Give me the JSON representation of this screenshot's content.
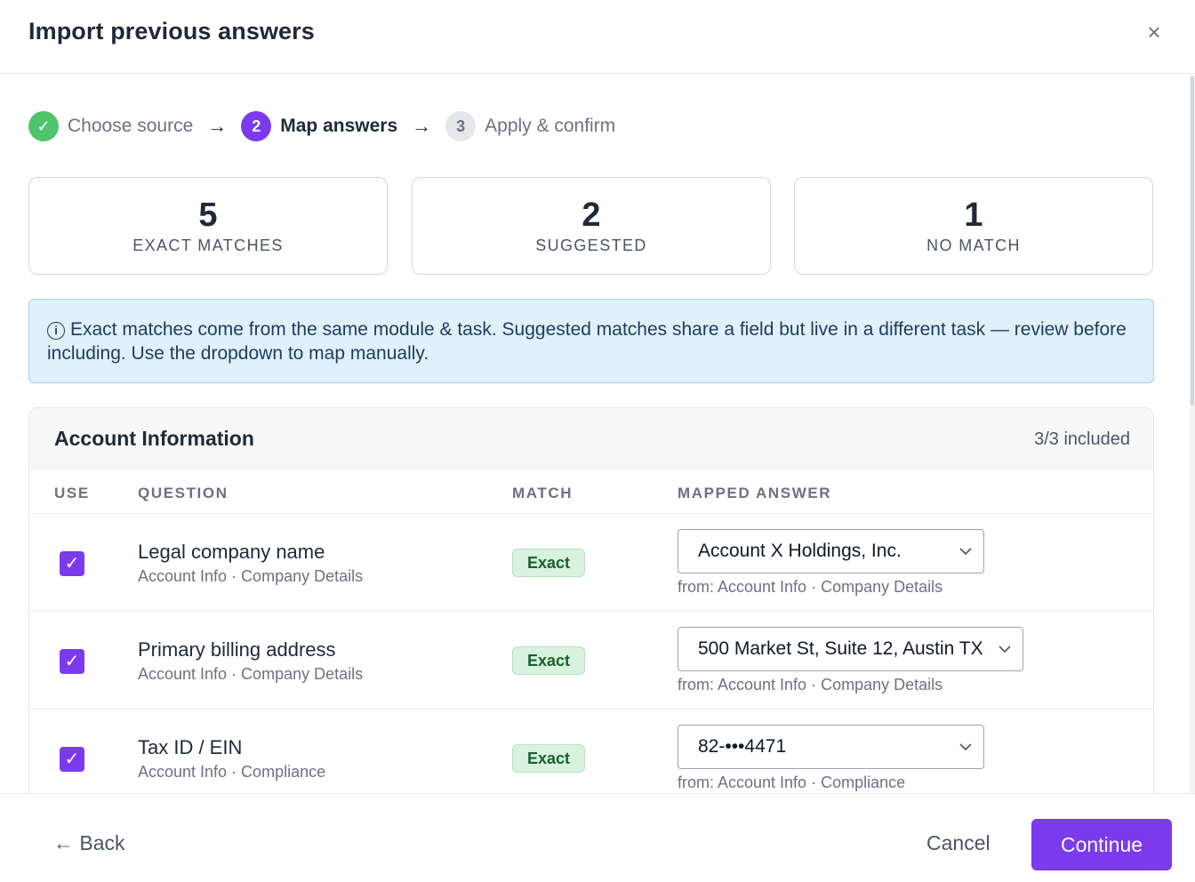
{
  "modal": {
    "title": "Import previous answers",
    "close_icon": "close-icon"
  },
  "stepper": {
    "steps": [
      {
        "label": "Choose source",
        "state": "done",
        "marker": "✓"
      },
      {
        "label": "Map answers",
        "state": "active",
        "marker": "2"
      },
      {
        "label": "Apply & confirm",
        "state": "todo",
        "marker": "3"
      }
    ],
    "arrow": "→"
  },
  "stats": [
    {
      "value": "5",
      "label": "EXACT MATCHES"
    },
    {
      "value": "2",
      "label": "SUGGESTED"
    },
    {
      "value": "1",
      "label": "NO MATCH"
    }
  ],
  "info_banner": {
    "icon": "ⓘ",
    "text": "Exact matches come from the same module & task. Suggested matches share a field but live in a different task — review before including. Use the dropdown to map manually."
  },
  "section": {
    "title": "Account Information",
    "count": "3/3 included",
    "columns": [
      "USE",
      "QUESTION",
      "MATCH",
      "MAPPED ANSWER"
    ],
    "rows": [
      {
        "checked": true,
        "question": "Legal company name",
        "path": "Account Info · Company Details",
        "match": "Exact",
        "answer": "Account X Holdings, Inc.",
        "from": "from: Account Info · Company Details"
      },
      {
        "checked": true,
        "question": "Primary billing address",
        "path": "Account Info · Company Details",
        "match": "Exact",
        "answer": "500 Market St, Suite 12, Austin TX",
        "from": "from: Account Info · Company Details"
      },
      {
        "checked": true,
        "question": "Tax ID / EIN",
        "path": "Account Info · Compliance",
        "match": "Exact",
        "answer": "82-•••4471",
        "from": "from: Account Info · Compliance"
      }
    ]
  },
  "footer": {
    "back": "← Back",
    "cancel": "Cancel",
    "continue": "Continue"
  },
  "colors": {
    "accent": "#7c3aed",
    "success": "#4ec46c",
    "info_bg": "#e1f1fc",
    "badge_bg": "#d9f2df"
  }
}
